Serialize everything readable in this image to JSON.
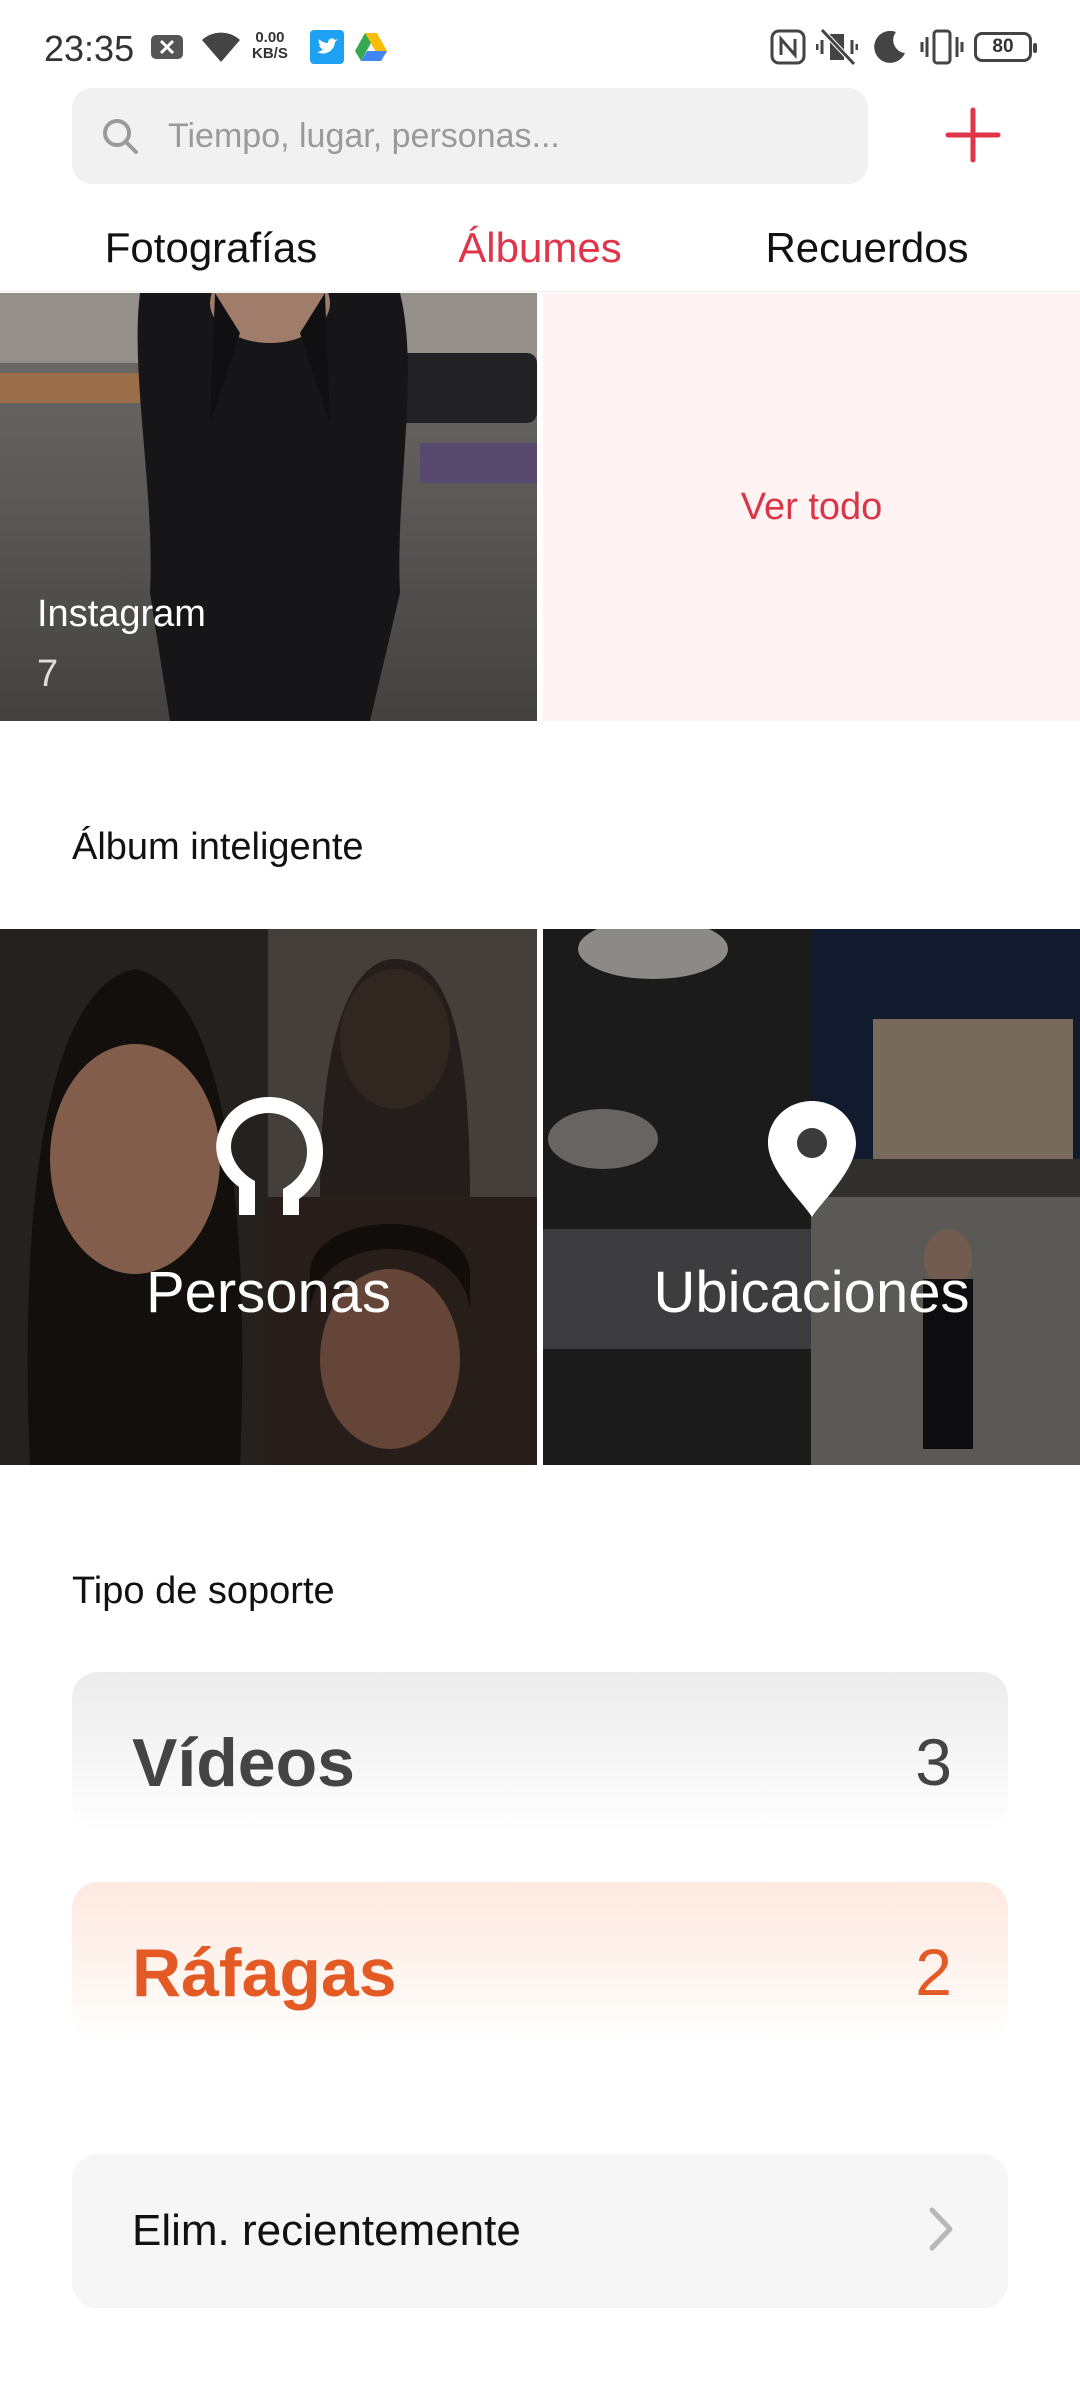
{
  "status_bar": {
    "time": "23:35",
    "net_speed_value": "0.00",
    "net_speed_unit": "KB/S",
    "battery": "80",
    "icons": [
      "notification-x-icon",
      "wifi-icon",
      "twitter-icon",
      "drive-icon",
      "nfc-icon",
      "vibrate-off-icon",
      "moon-icon",
      "vibrate-icon",
      "battery-icon"
    ]
  },
  "search": {
    "placeholder": "Tiempo, lugar, personas..."
  },
  "tabs": [
    {
      "label": "Fotografías",
      "active": false
    },
    {
      "label": "Álbumes",
      "active": true
    },
    {
      "label": "Recuerdos",
      "active": false
    }
  ],
  "albums": {
    "instagram": {
      "title": "Instagram",
      "count": "7"
    },
    "view_all": "Ver todo"
  },
  "smart_album": {
    "heading": "Álbum inteligente",
    "people": "Personas",
    "places": "Ubicaciones"
  },
  "media_type": {
    "heading": "Tipo de soporte",
    "videos": {
      "label": "Vídeos",
      "count": "3"
    },
    "bursts": {
      "label": "Ráfagas",
      "count": "2"
    }
  },
  "recently_deleted": "Elim. recientemente",
  "colors": {
    "accent": "#e0344a",
    "burst": "#e35a24"
  }
}
